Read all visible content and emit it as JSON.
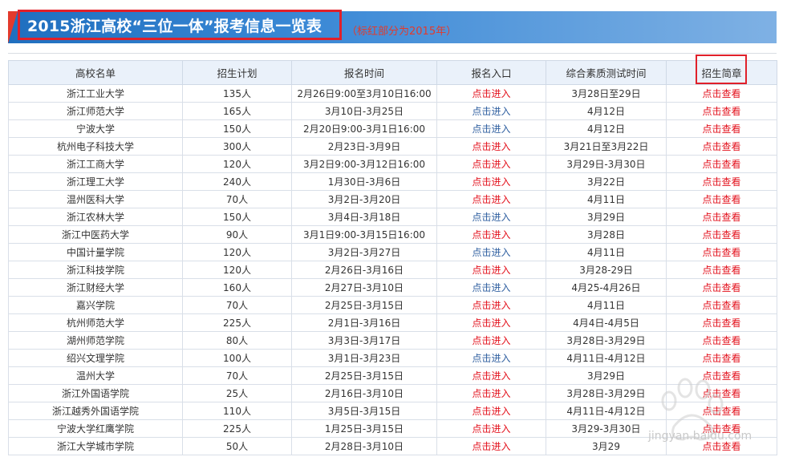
{
  "header": {
    "title": "2015浙江高校“三位一体”报考信息一览表",
    "note": "（标红部分为2015年）"
  },
  "colors": {
    "banner": "#2a7acb",
    "accent_red": "#e33a2c",
    "link_red": "#e3111c",
    "link_blue": "#2f5fa0",
    "header_bg": "#eaf1fa"
  },
  "table": {
    "columns": [
      "高校名单",
      "招生计划",
      "报名时间",
      "报名入口",
      "综合素质测试时间",
      "招生简章"
    ],
    "rows": [
      {
        "school": "浙江工业大学",
        "plan": "135人",
        "signup": "2月26日9:00至3月10日16:00",
        "entry": "点击进入",
        "entry_red": true,
        "test": "3月28日至29日",
        "brochure": "点击查看"
      },
      {
        "school": "浙江师范大学",
        "plan": "165人",
        "signup": "3月10日-3月25日",
        "entry": "点击进入",
        "entry_red": false,
        "test": "4月12日",
        "brochure": "点击查看"
      },
      {
        "school": "宁波大学",
        "plan": "150人",
        "signup": "2月20日9:00-3月1日16:00",
        "entry": "点击进入",
        "entry_red": false,
        "test": "4月12日",
        "brochure": "点击查看"
      },
      {
        "school": "杭州电子科技大学",
        "plan": "300人",
        "signup": "2月23日-3月9日",
        "entry": "点击进入",
        "entry_red": true,
        "test": "3月21日至3月22日",
        "brochure": "点击查看"
      },
      {
        "school": "浙江工商大学",
        "plan": "120人",
        "signup": "3月2日9:00-3月12日16:00",
        "entry": "点击进入",
        "entry_red": true,
        "test": "3月29日-3月30日",
        "brochure": "点击查看"
      },
      {
        "school": "浙江理工大学",
        "plan": "240人",
        "signup": "1月30日-3月6日",
        "entry": "点击进入",
        "entry_red": true,
        "test": "3月22日",
        "brochure": "点击查看"
      },
      {
        "school": "温州医科大学",
        "plan": "70人",
        "signup": "3月2日-3月20日",
        "entry": "点击进入",
        "entry_red": true,
        "test": "4月11日",
        "brochure": "点击查看"
      },
      {
        "school": "浙江农林大学",
        "plan": "150人",
        "signup": "3月4日-3月18日",
        "entry": "点击进入",
        "entry_red": false,
        "test": "3月29日",
        "brochure": "点击查看"
      },
      {
        "school": "浙江中医药大学",
        "plan": "90人",
        "signup": "3月1日9:00-3月15日16:00",
        "entry": "点击进入",
        "entry_red": true,
        "test": "3月28日",
        "brochure": "点击查看"
      },
      {
        "school": "中国计量学院",
        "plan": "120人",
        "signup": "3月2日-3月27日",
        "entry": "点击进入",
        "entry_red": false,
        "test": "4月11日",
        "brochure": "点击查看"
      },
      {
        "school": "浙江科技学院",
        "plan": "120人",
        "signup": "2月26日-3月16日",
        "entry": "点击进入",
        "entry_red": true,
        "test": "3月28-29日",
        "brochure": "点击查看"
      },
      {
        "school": "浙江财经大学",
        "plan": "160人",
        "signup": "2月27日-3月10日",
        "entry": "点击进入",
        "entry_red": false,
        "test": "4月25-4月26日",
        "brochure": "点击查看"
      },
      {
        "school": "嘉兴学院",
        "plan": "70人",
        "signup": "2月25日-3月15日",
        "entry": "点击进入",
        "entry_red": true,
        "test": "4月11日",
        "brochure": "点击查看"
      },
      {
        "school": "杭州师范大学",
        "plan": "225人",
        "signup": "2月1日-3月16日",
        "entry": "点击进入",
        "entry_red": true,
        "test": "4月4日-4月5日",
        "brochure": "点击查看"
      },
      {
        "school": "湖州师范学院",
        "plan": "80人",
        "signup": "3月3日-3月17日",
        "entry": "点击进入",
        "entry_red": true,
        "test": "3月28日-3月29日",
        "brochure": "点击查看"
      },
      {
        "school": "绍兴文理学院",
        "plan": "100人",
        "signup": "3月1日-3月23日",
        "entry": "点击进入",
        "entry_red": false,
        "test": "4月11日-4月12日",
        "brochure": "点击查看"
      },
      {
        "school": "温州大学",
        "plan": "70人",
        "signup": "2月25日-3月15日",
        "entry": "点击进入",
        "entry_red": true,
        "test": "3月29日",
        "brochure": "点击查看"
      },
      {
        "school": "浙江外国语学院",
        "plan": "25人",
        "signup": "2月16日-3月10日",
        "entry": "点击进入",
        "entry_red": true,
        "test": "3月28日-3月29日",
        "brochure": "点击查看"
      },
      {
        "school": "浙江越秀外国语学院",
        "plan": "110人",
        "signup": "3月5日-3月15日",
        "entry": "点击进入",
        "entry_red": true,
        "test": "4月11日-4月12日",
        "brochure": "点击查看"
      },
      {
        "school": "宁波大学红鹰学院",
        "plan": "225人",
        "signup": "1月25日-3月15日",
        "entry": "点击进入",
        "entry_red": true,
        "test": "3月29-3月30日",
        "brochure": "点击查看"
      },
      {
        "school": "浙江大学城市学院",
        "plan": "50人",
        "signup": "2月28日-3月10日",
        "entry": "点击进入",
        "entry_red": true,
        "test": "3月29",
        "brochure": "点击查看"
      }
    ]
  },
  "watermark": {
    "text": "jingyan.baidu.com"
  }
}
